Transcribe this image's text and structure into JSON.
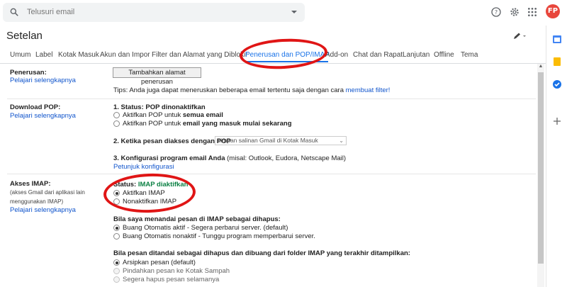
{
  "search": {
    "placeholder": "Telusuri email"
  },
  "icons": {
    "search": "search-icon",
    "help": "help-icon",
    "settings": "gear-icon",
    "apps": "apps-grid-icon",
    "avatar_letters": "FP"
  },
  "settings": {
    "title": "Setelan"
  },
  "tabs": [
    {
      "label": "Umum"
    },
    {
      "label": "Label"
    },
    {
      "label": "Kotak Masuk"
    },
    {
      "label": "Akun dan Impor"
    },
    {
      "label": "Filter dan Alamat yang Diblokir"
    },
    {
      "label": "Penerusan dan POP/IMAP",
      "active": true
    },
    {
      "label": "Add-on"
    },
    {
      "label": "Chat dan Rapat"
    },
    {
      "label": "Lanjutan"
    },
    {
      "label": "Offline"
    },
    {
      "label": "Tema"
    }
  ],
  "forwarding": {
    "label": "Penerusan:",
    "learn_more": "Pelajari selengkapnya",
    "add_button": "Tambahkan alamat penerusan",
    "tip_text": "Tips: Anda juga dapat meneruskan beberapa email tertentu saja dengan cara",
    "tip_link": "membuat filter!"
  },
  "pop": {
    "label": "Download POP:",
    "learn_more": "Pelajari selengkapnya",
    "status_heading": "1. Status: POP dinonaktifkan",
    "opt1_prefix": "Aktifkan POP untuk",
    "opt1_bold": "semua email",
    "opt2_prefix": "Aktifkan POP untuk",
    "opt2_bold": "email yang masuk mulai sekarang",
    "when_heading": "2. Ketika pesan diakses dengan POP",
    "when_select": "simpan salinan Gmail di Kotak Masuk",
    "config_heading": "3. Konfigurasi program email Anda",
    "config_hint": "(misal: Outlook, Eudora, Netscape Mail)",
    "config_link": "Petunjuk konfigurasi"
  },
  "imap": {
    "label": "Akses IMAP:",
    "sub1": "(akses Gmail dari aplikasi lain",
    "sub2": "menggunakan IMAP)",
    "learn_more": "Pelajari selengkapnya",
    "status_label": "Status:",
    "status_value": "IMAP diaktifkan",
    "opt_enable": "Aktifkan IMAP",
    "opt_disable": "Nonaktifkan IMAP",
    "delete_heading": "Bila saya menandai pesan di IMAP sebagai dihapus:",
    "auto_on": "Buang Otomatis aktif - Segera perbarui server. (default)",
    "auto_off": "Buang Otomatis nonaktif - Tunggu program memperbarui server.",
    "expunge_heading": "Bila pesan ditandai sebagai dihapus dan dibuang dari folder IMAP yang terakhir ditampilkan:",
    "archive": "Arsipkan pesan (default)",
    "trash": "Pindahkan pesan ke Kotak Sampah",
    "delete_forever": "Segera hapus pesan selamanya"
  },
  "colors": {
    "accent": "#1a73e8",
    "link": "#1155cc",
    "status_green": "#0b8043",
    "annotation_red": "#e01515"
  }
}
